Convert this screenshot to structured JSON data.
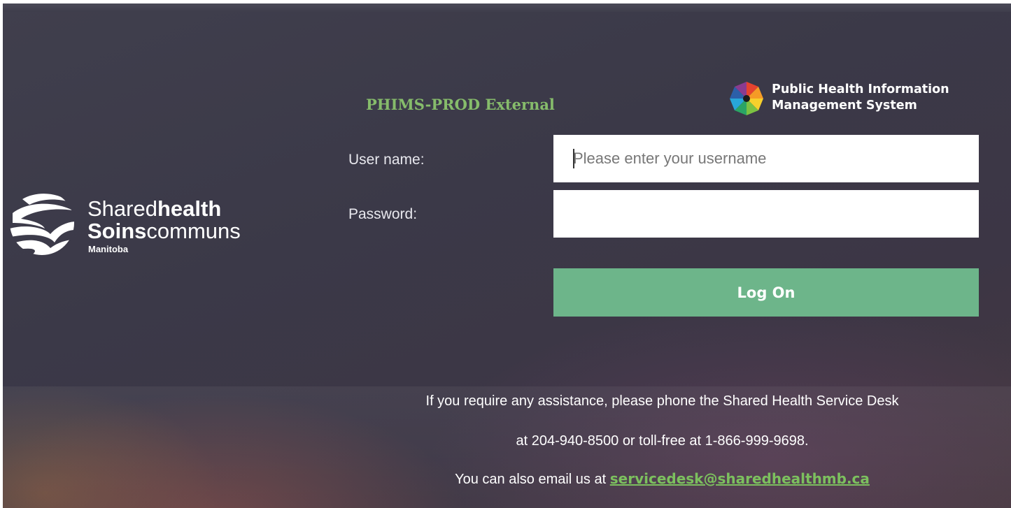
{
  "brand": {
    "line1_light": "Shared",
    "line1_bold": "health",
    "line2_bold": "Soins",
    "line2_light": "communs",
    "line3": "Manitoba"
  },
  "header": {
    "env_title": "PHIMS-PROD External",
    "system_logo_line1": "Public Health Information",
    "system_logo_line2": "Management System"
  },
  "form": {
    "username_label": "User name:",
    "username_placeholder": "Please enter your username",
    "username_value": "",
    "password_label": "Password:",
    "password_value": "",
    "logon_label": "Log On"
  },
  "help": {
    "line1": "If you require any assistance, please phone the Shared Health Service Desk",
    "line2": "at 204-940-8500 or toll-free at 1-866-999-9698.",
    "line3_prefix": "You can also email us at",
    "email": "servicedesk@sharedhealthmb.ca"
  },
  "colors": {
    "accent_green": "#6db58a",
    "title_green": "#86bc6b",
    "link_green": "#7cc05e",
    "background": "#3d3b49"
  }
}
